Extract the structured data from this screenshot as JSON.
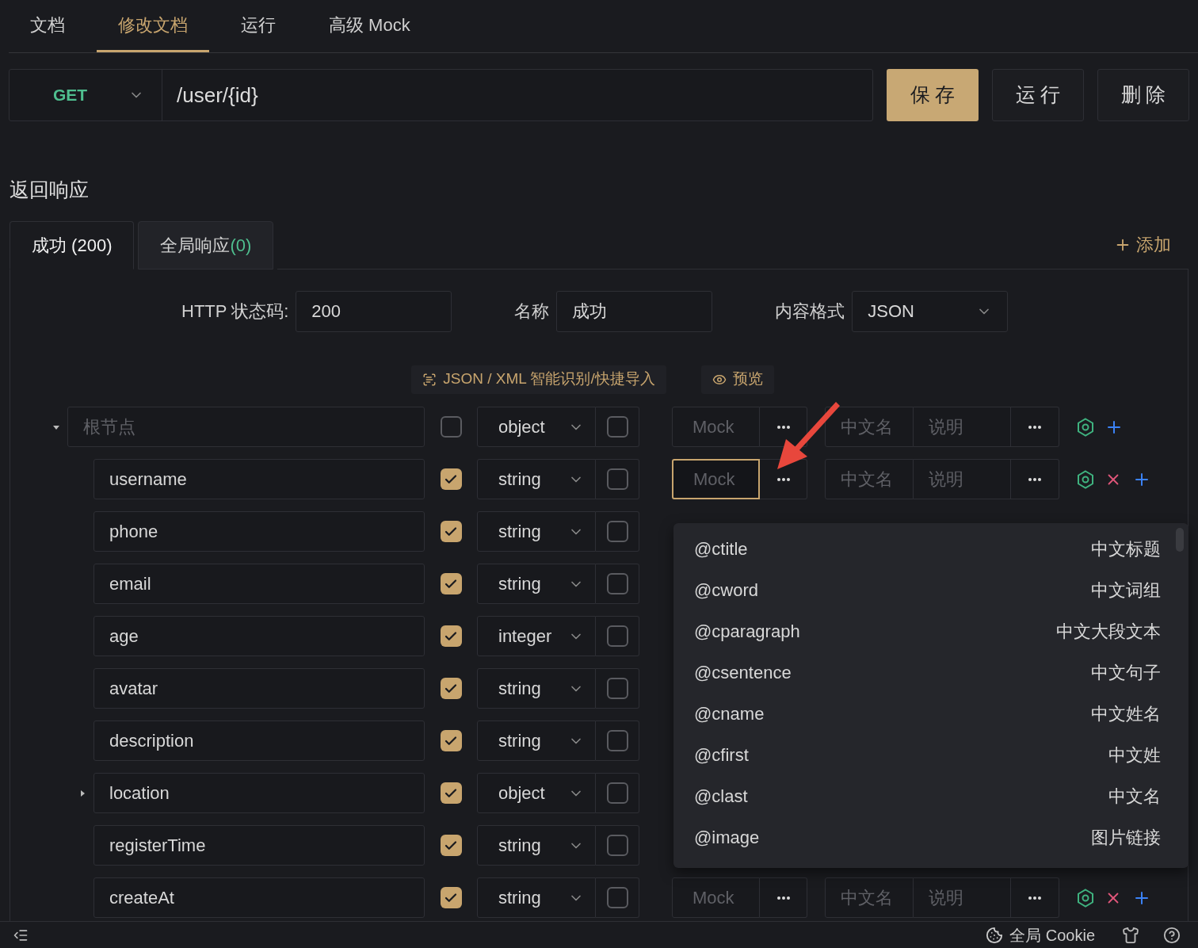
{
  "tabs": [
    {
      "label": "文档",
      "selected": false
    },
    {
      "label": "修改文档",
      "selected": true
    },
    {
      "label": "运行",
      "selected": false
    },
    {
      "label": "高级 Mock",
      "selected": false
    }
  ],
  "request": {
    "method": "GET",
    "path": "/user/{id}",
    "buttons": [
      {
        "label": "保 存",
        "primary": true
      },
      {
        "label": "运 行",
        "primary": false
      },
      {
        "label": "删 除",
        "primary": false
      }
    ]
  },
  "section_title": "返回响应",
  "response_tabs": [
    {
      "label": "成功 (200)",
      "selected": true
    },
    {
      "label": "全局响应",
      "count": "(0)",
      "selected": false
    }
  ],
  "add_label": "添加",
  "form": {
    "status_label": "HTTP 状态码:",
    "status_value": "200",
    "name_label": "名称",
    "name_value": "成功",
    "format_label": "内容格式",
    "format_value": "JSON"
  },
  "tools": [
    {
      "kind": "import",
      "label": "JSON / XML 智能识别/快捷导入"
    },
    {
      "kind": "preview",
      "label": "预览"
    }
  ],
  "tree": {
    "placeholder": "根节点",
    "expanded": true,
    "required": false,
    "type": "object",
    "nullable": false,
    "mock": {
      "placeholder": "Mock",
      "focused": false,
      "title_placeholder": "中文名",
      "description_placeholder": "说明"
    },
    "actions": [
      {
        "kind": "settings"
      },
      {
        "kind": "add"
      }
    ],
    "children": [
      {
        "name": "username",
        "required": true,
        "type": "string",
        "nullable": false,
        "mock": {
          "placeholder": "Mock",
          "focused": true,
          "title_placeholder": "中文名",
          "description_placeholder": "说明"
        },
        "actions": [
          {
            "kind": "settings"
          },
          {
            "kind": "delete"
          },
          {
            "kind": "add"
          }
        ]
      },
      {
        "name": "phone",
        "required": true,
        "type": "string",
        "nullable": false
      },
      {
        "name": "email",
        "required": true,
        "type": "string",
        "nullable": false
      },
      {
        "name": "age",
        "required": true,
        "type": "integer",
        "nullable": false
      },
      {
        "name": "avatar",
        "required": true,
        "type": "string",
        "nullable": false
      },
      {
        "name": "description",
        "required": true,
        "type": "string",
        "nullable": false
      },
      {
        "name": "location",
        "expanded": false,
        "required": true,
        "type": "object",
        "nullable": false
      },
      {
        "name": "registerTime",
        "required": true,
        "type": "string",
        "nullable": false
      },
      {
        "name": "createAt",
        "required": true,
        "type": "string",
        "nullable": false,
        "mock": {
          "placeholder": "Mock",
          "focused": false,
          "title_placeholder": "中文名",
          "description_placeholder": "说明"
        },
        "actions": [
          {
            "kind": "settings"
          },
          {
            "kind": "delete"
          },
          {
            "kind": "add"
          }
        ]
      }
    ]
  },
  "mock_menu": [
    {
      "rule": "@ctitle",
      "meaning": "中文标题"
    },
    {
      "rule": "@cword",
      "meaning": "中文词组"
    },
    {
      "rule": "@cparagraph",
      "meaning": "中文大段文本"
    },
    {
      "rule": "@csentence",
      "meaning": "中文句子"
    },
    {
      "rule": "@cname",
      "meaning": "中文姓名"
    },
    {
      "rule": "@cfirst",
      "meaning": "中文姓"
    },
    {
      "rule": "@clast",
      "meaning": "中文名"
    },
    {
      "rule": "@image",
      "meaning": "图片链接"
    }
  ],
  "status_bar": {
    "cookie_label": "全局 Cookie"
  }
}
